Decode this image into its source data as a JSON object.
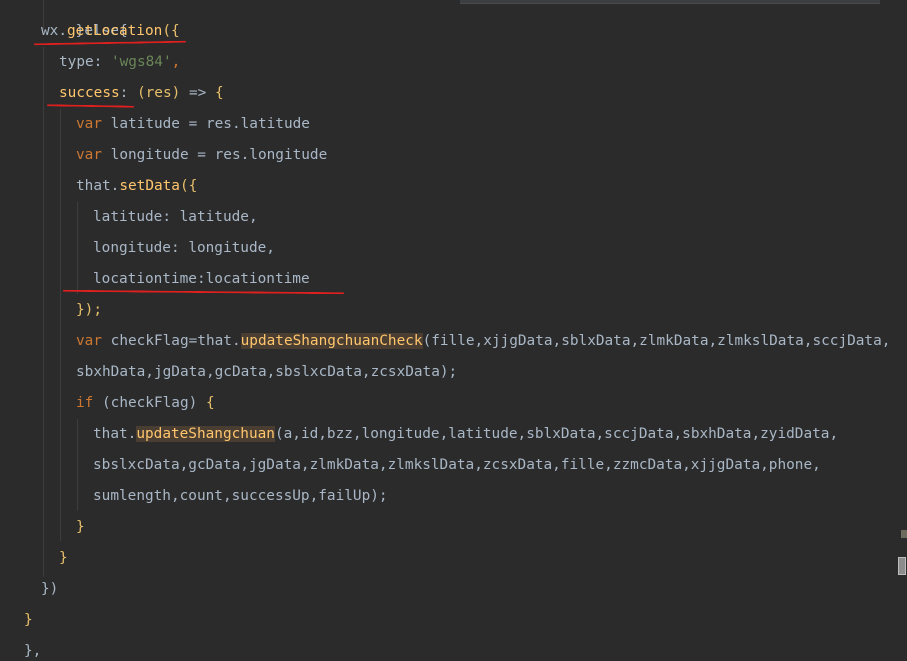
{
  "code": {
    "line0": {
      "text": "}else{"
    },
    "line1": {
      "obj": "wx",
      "dot": ".",
      "fn": "getLocation",
      "paren": "({"
    },
    "line2": {
      "key": "type",
      "colon": ": ",
      "value": "'wgs84'",
      "comma": ","
    },
    "line3": {
      "key": "success",
      "colon": ": ",
      "params": "(res)",
      "arrow": " => ",
      "brace": "{"
    },
    "line4": {
      "kw": "var",
      "rest": " latitude = res.latitude"
    },
    "line5": {
      "kw": "var",
      "rest": " longitude = res.longitude"
    },
    "line6": {
      "obj": "that",
      "dot": ".",
      "fn": "setData",
      "paren": "({"
    },
    "line7": {
      "key": "latitude",
      "colon": ": ",
      "value": "latitude,"
    },
    "line8": {
      "key": "longitude",
      "colon": ": ",
      "value": "longitude,"
    },
    "line9": {
      "key": "locationtime",
      "colon": ":",
      "value": "locationtime"
    },
    "line10": {
      "text": "});"
    },
    "line11": {
      "kw": "var",
      "pre": " checkFlag=that.",
      "fn": "updateShangchuanCheck",
      "args": "(fille,xjjgData,sblxData,zlmkData,zlmkslData,sccjData,"
    },
    "line12": {
      "text": "sbxhData,jgData,gcData,sbslxcData,zcsxData);"
    },
    "line13": {
      "kw": "if",
      "cond": " (checkFlag) ",
      "brace": "{"
    },
    "line14": {
      "pre": "that.",
      "fn": "updateShangchuan",
      "args": "(a,id,bzz,longitude,latitude,sblxData,sccjData,sbxhData,zyidData,"
    },
    "line15": {
      "text": "sbslxcData,gcData,jgData,zlmkData,zlmkslData,zcsxData,fille,zzmcData,xjjgData,phone,"
    },
    "line16": {
      "text": "sumlength,count,successUp,failUp);"
    },
    "line17": {
      "text": "}"
    },
    "line18": {
      "text": "}"
    },
    "line19": {
      "text": "})"
    },
    "line20": {
      "text": "}"
    },
    "line21": {
      "text": "},"
    }
  },
  "colors": {
    "background": "#2b2b2b",
    "keyword": "#cc7832",
    "function": "#ffc66d",
    "string": "#6a8759",
    "text": "#a9b7c6",
    "annotation_mark": "#e0201e",
    "highlight": "#4a3d31"
  }
}
